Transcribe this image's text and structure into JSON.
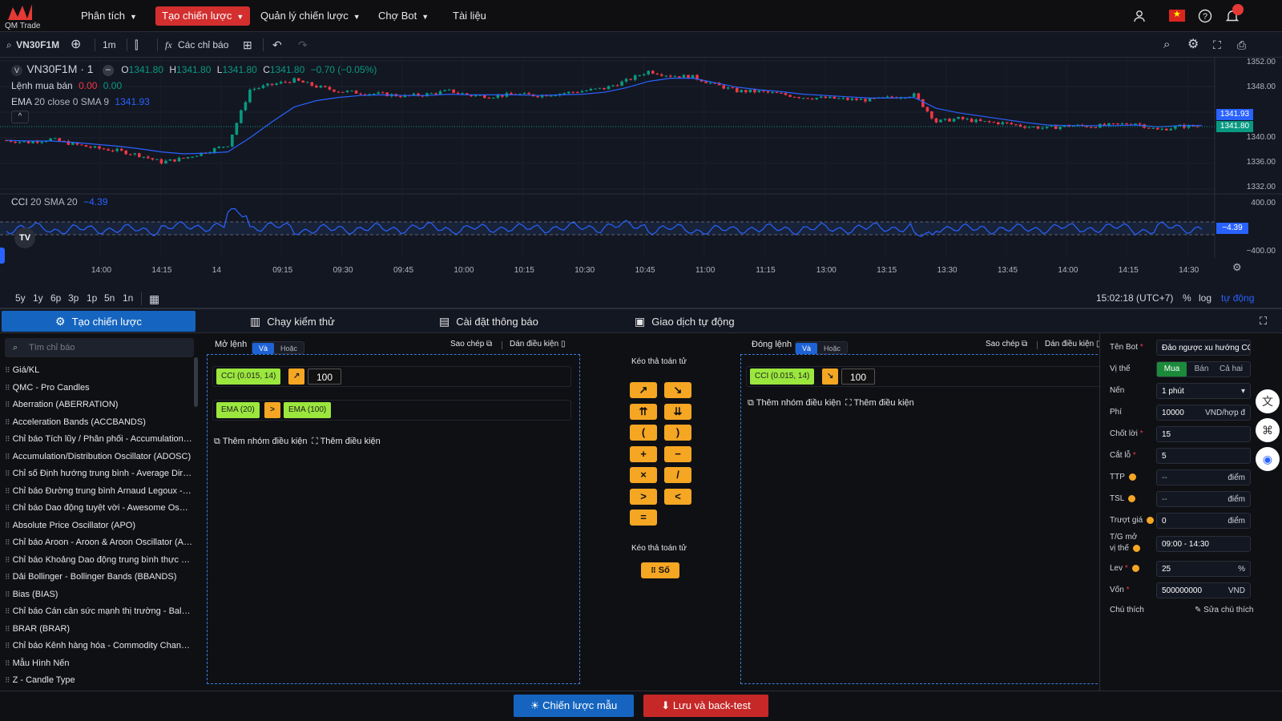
{
  "app": {
    "logo_text": "QM Trade"
  },
  "nav": {
    "items": [
      {
        "label": "Phân tích",
        "dropdown": true
      },
      {
        "label": "Tạo chiến lược",
        "dropdown": true,
        "active": true
      },
      {
        "label": "Quản lý chiến lược",
        "dropdown": true
      },
      {
        "label": "Chợ Bot",
        "dropdown": true
      },
      {
        "label": "Tài liệu",
        "dropdown": false
      }
    ],
    "icons": [
      "user-icon",
      "vietnam-flag-icon",
      "help-icon",
      "bell-icon"
    ]
  },
  "toolbar": {
    "symbol": "VN30F1M",
    "interval": "1m",
    "indicators_label": "Các chỉ báo"
  },
  "chart_header": {
    "title": "VN30F1M · 1",
    "o_label": "O",
    "o": "1341.80",
    "h_label": "H",
    "h": "1341.80",
    "l_label": "L",
    "l": "1341.80",
    "c_label": "C",
    "c": "1341.80",
    "change": "−0.70 (−0.05%)",
    "orders_label": "Lệnh mua bán",
    "orders_a": "0.00",
    "orders_b": "0.00",
    "ema_label": "EMA",
    "ema_params": "20 close 0 SMA 9",
    "ema_value": "1341.93",
    "cci_label": "CCI",
    "cci_params": "20 SMA 20",
    "cci_value": "−4.39"
  },
  "price_axis": [
    "1352.00",
    "1348.00",
    "1344.00",
    "1340.00",
    "1336.00",
    "1332.00"
  ],
  "price_tags": {
    "ema": "1341.93",
    "last": "1341.80",
    "cci": "−4.39"
  },
  "cci_axis": [
    "400.00",
    "−400.00"
  ],
  "time_axis": [
    "14:00",
    "14:15",
    "14",
    "09:15",
    "09:30",
    "09:45",
    "10:00",
    "10:15",
    "10:30",
    "10:45",
    "11:00",
    "11:15",
    "13:00",
    "13:15",
    "13:30",
    "13:45",
    "14:00",
    "14:15",
    "14:30"
  ],
  "chart_data": {
    "type": "line",
    "title": "VN30F1M · 1",
    "ylim": [
      1332,
      1352
    ],
    "series": [
      {
        "name": "VN30F1M · 1",
        "values": [
          1339.6,
          1339.3,
          1339.8,
          1339.0,
          1338.4,
          1338.0,
          1337.3,
          1336.2,
          1336.8,
          1337.8,
          1338.9,
          1347.5,
          1348.3,
          1349.0,
          1348.0,
          1347.3,
          1347.0,
          1346.8,
          1346.5,
          1346.8,
          1347.3,
          1346.6,
          1346.5,
          1346.8,
          1346.6,
          1346.9,
          1347.3,
          1347.7,
          1348.9,
          1350.4,
          1349.7,
          1349.5,
          1348.3,
          1347.3,
          1347.2,
          1346.8,
          1346.3,
          1346.2,
          1346.0,
          1345.9,
          1346.3,
          1346.7,
          1342.5,
          1343.0,
          1342.5,
          1342.3,
          1341.8,
          1341.5,
          1341.9,
          1341.8,
          1342.0,
          1342.3,
          1341.2,
          1341.8,
          1341.8
        ]
      },
      {
        "name": "EMA",
        "values": [
          1339.6,
          1339.5,
          1339.5,
          1339.3,
          1339.0,
          1338.7,
          1338.3,
          1337.8,
          1337.5,
          1337.6,
          1337.8,
          1340.0,
          1342.5,
          1344.8,
          1345.8,
          1346.3,
          1346.6,
          1346.7,
          1346.6,
          1346.6,
          1346.8,
          1346.7,
          1346.7,
          1346.7,
          1346.6,
          1346.7,
          1346.8,
          1347.1,
          1347.8,
          1348.8,
          1349.3,
          1349.3,
          1348.6,
          1347.9,
          1347.5,
          1347.2,
          1346.8,
          1346.6,
          1346.4,
          1346.2,
          1346.2,
          1346.3,
          1344.6,
          1343.9,
          1343.4,
          1342.9,
          1342.4,
          1342.0,
          1341.9,
          1341.9,
          1341.9,
          1342.0,
          1341.7,
          1341.9,
          1341.93
        ]
      }
    ]
  },
  "timeframes": [
    "5y",
    "1y",
    "6p",
    "3p",
    "1p",
    "5n",
    "1n"
  ],
  "clock": "15:02:18 (UTC+7)",
  "scale_opts": [
    "%",
    "log",
    "tự động"
  ],
  "tabs": [
    "Tạo chiến lược",
    "Chạy kiểm thử",
    "Cài đặt thông báo",
    "Giao dịch tự động"
  ],
  "indicator_search_placeholder": "Tìm chỉ báo",
  "indicators": [
    "Giá/KL",
    "QMC - Pro Candles",
    "Aberration (ABERRATION)",
    "Acceleration Bands (ACCBANDS)",
    "Chỉ báo Tích lũy / Phân phối - Accumulation/Distribution",
    "Accumulation/Distribution Oscillator (ADOSC)",
    "Chỉ số Định hướng trung bình - Average Directional",
    "Chỉ báo Đường trung bình Arnaud Legoux - Arnaud",
    "Chỉ báo Dao động tuyệt vời - Awesome Oscillator",
    "Absolute Price Oscillator (APO)",
    "Chỉ báo Aroon - Aroon & Aroon Oscillator (AROON)",
    "Chỉ báo Khoảng Dao động trung bình thực tế - ATR",
    "Dải Bollinger - Bollinger Bands (BBANDS)",
    "Bias (BIAS)",
    "Chỉ báo Cán cân sức mạnh thị trường - Balance of Power",
    "BRAR (BRAR)",
    "Chỉ báo Kênh hàng hóa - Commodity Channel Index",
    "Mẫu Hình Nến",
    "Z - Candle Type"
  ],
  "open_panel": {
    "title": "Mở lệnh",
    "and_label": "Và",
    "or_label": "Hoặc",
    "copy_label": "Sao chép",
    "paste_label": "Dán điều kiện",
    "cond1": {
      "left": "CCI (0.015, 14)",
      "op": "↗",
      "right": "100"
    },
    "cond2": {
      "left": "EMA (20)",
      "op": ">",
      "right": "EMA (100)"
    },
    "add_group": "Thêm nhóm điều kiện",
    "add_cond": "Thêm điều kiện"
  },
  "operators": {
    "title": "Kéo thả toán tử",
    "items": [
      "↗",
      "↘",
      "⇈",
      "⇊",
      "(",
      ")",
      "+",
      "−",
      "×",
      "/",
      ">",
      "<",
      "="
    ],
    "title2": "Kéo thả toán tử",
    "number_label": "Số"
  },
  "close_panel": {
    "title": "Đóng lệnh",
    "and_label": "Và",
    "or_label": "Hoặc",
    "copy_label": "Sao chép",
    "paste_label": "Dán điều kiện",
    "cond1": {
      "left": "CCI (0.015, 14)",
      "op": "↘",
      "right": "100"
    },
    "add_group": "Thêm nhóm điều kiện",
    "add_cond": "Thêm điều kiện"
  },
  "form": {
    "bot_name_label": "Tên Bot",
    "bot_name": "Đảo ngược xu hướng CC",
    "position_label": "Vị thế",
    "position_opts": [
      "Mua",
      "Bán",
      "Cả hai"
    ],
    "candle_label": "Nến",
    "candle_value": "1 phút",
    "fee_label": "Phí",
    "fee_value": "10000",
    "fee_unit": "VND/hợp đ",
    "tp_label": "Chốt lời",
    "tp_value": "15",
    "sl_label": "Cắt lỗ",
    "sl_value": "5",
    "ttp_label": "TTP",
    "ttp_value": "--",
    "ttp_unit": "điểm",
    "tsl_label": "TSL",
    "tsl_value": "--",
    "tsl_unit": "điểm",
    "slip_label": "Trượt giá",
    "slip_value": "0",
    "slip_unit": "điểm",
    "time_label_1": "T/G mở",
    "time_label_2": "vị thế",
    "time_value": "09:00 - 14:30",
    "lev_label": "Lev",
    "lev_value": "25",
    "lev_unit": "%",
    "capital_label": "Vốn",
    "capital_value": "500000000",
    "capital_unit": "VND",
    "note_label": "Chú thích",
    "note_edit": "Sửa chú thích"
  },
  "bottom": {
    "sample_label": "Chiến lược mẫu",
    "save_label": "Lưu và back-test"
  },
  "colors": {
    "up": "#089981",
    "down": "#f23645",
    "ema": "#2962ff",
    "active_nav": "#d32f2f",
    "active_tab": "#1565c0",
    "chip_green": "#9be73e",
    "chip_orange": "#f5a623"
  }
}
